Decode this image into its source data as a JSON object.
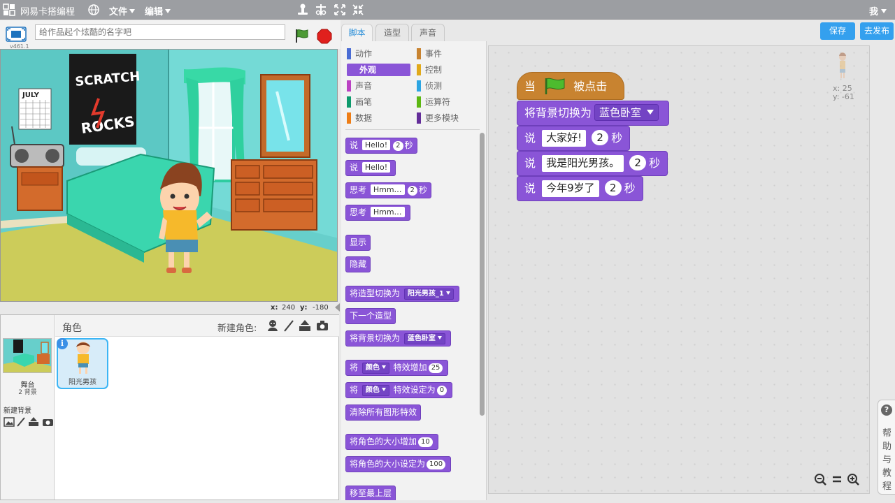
{
  "app": {
    "title": "网易卡搭编程",
    "menus": {
      "file": "文件",
      "edit": "编辑"
    },
    "user": "我",
    "version": "v461.1"
  },
  "stage": {
    "title_placeholder": "给作品起个炫酷的名字吧",
    "poster_text": [
      "SCRATCH",
      "ROCKS"
    ],
    "calendar_text": "JULY",
    "coord": {
      "x_label": "x:",
      "x": "240",
      "y_label": "y:",
      "y": "-180"
    }
  },
  "sprites": {
    "header": "角色",
    "new_sprite_label": "新建角色:",
    "stage_label": "舞台",
    "stage_count": "2 背景",
    "new_backdrop_label": "新建背景",
    "items": [
      {
        "name": "阳光男孩"
      }
    ]
  },
  "tabs": [
    {
      "label": "脚本",
      "active": true
    },
    {
      "label": "造型",
      "active": false
    },
    {
      "label": "声音",
      "active": false
    }
  ],
  "categories": [
    {
      "label": "动作",
      "color": "#4a6cd4"
    },
    {
      "label": "事件",
      "color": "#c88330"
    },
    {
      "label": "外观",
      "color": "#8a55d7",
      "selected": true
    },
    {
      "label": "控制",
      "color": "#e1a91a"
    },
    {
      "label": "声音",
      "color": "#bb42c3"
    },
    {
      "label": "侦测",
      "color": "#2ca5e2"
    },
    {
      "label": "画笔",
      "color": "#0e9a6c"
    },
    {
      "label": "运算符",
      "color": "#5cb712"
    },
    {
      "label": "数据",
      "color": "#ee7d16"
    },
    {
      "label": "更多模块",
      "color": "#632d99"
    }
  ],
  "palette_blocks": [
    {
      "pre": "说",
      "input": "Hello!",
      "num": "2",
      "post": "秒"
    },
    {
      "pre": "说",
      "input": "Hello!"
    },
    {
      "pre": "思考",
      "input": "Hmm…",
      "num": "2",
      "post": "秒"
    },
    {
      "pre": "思考",
      "input": "Hmm…"
    },
    {
      "pre": "显示"
    },
    {
      "pre": "隐藏"
    },
    {
      "pre": "将造型切换为",
      "dropdown": "阳光男孩_1"
    },
    {
      "pre": "下一个造型"
    },
    {
      "pre": "将背景切换为",
      "dropdown": "蓝色卧室"
    },
    {
      "pre": "将",
      "dropdown": "颜色",
      "mid": "特效增加",
      "num": "25"
    },
    {
      "pre": "将",
      "dropdown": "颜色",
      "mid": "特效设定为",
      "num": "0"
    },
    {
      "pre": "清除所有图形特效"
    },
    {
      "pre": "将角色的大小增加",
      "num": "10"
    },
    {
      "pre": "将角色的大小设定为",
      "num": "100"
    },
    {
      "pre": "移至最上层"
    }
  ],
  "script": {
    "hat": {
      "pre": "当",
      "post": "被点击"
    },
    "blocks": [
      {
        "pre": "将背景切换为",
        "dropdown": "蓝色卧室"
      },
      {
        "pre": "说",
        "input": "大家好!",
        "num": "2",
        "post": "秒"
      },
      {
        "pre": "说",
        "input": "我是阳光男孩。",
        "num": "2",
        "post": "秒"
      },
      {
        "pre": "说",
        "input": "今年9岁了",
        "num": "2",
        "post": "秒"
      }
    ]
  },
  "sprite_info": {
    "x_label": "x:",
    "x": "25",
    "y_label": "y:",
    "y": "-61"
  },
  "buttons": {
    "save": "保存",
    "publish": "去发布"
  },
  "help": {
    "q": "?",
    "text": [
      "帮",
      "助",
      "与",
      "教",
      "程"
    ]
  }
}
